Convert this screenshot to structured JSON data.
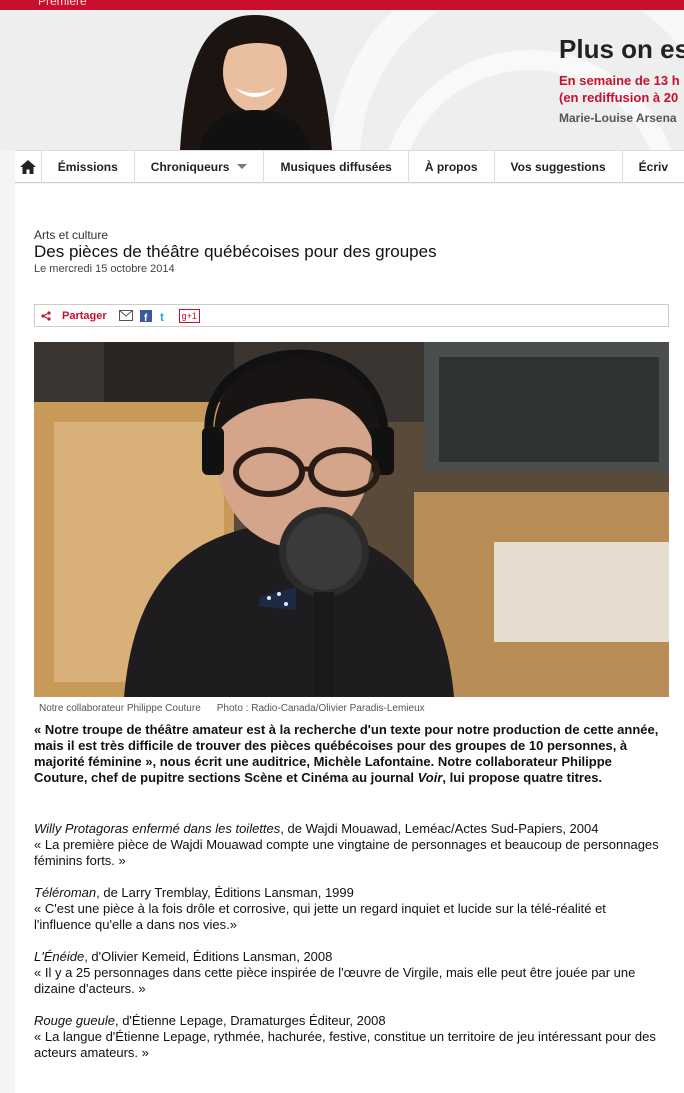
{
  "header": {
    "brand": "Première",
    "show_title": "Plus on es",
    "schedule_line1": "En semaine de 13 h",
    "schedule_line2": "(en rediffusion à 20",
    "host": "Marie-Louise Arsena"
  },
  "nav": {
    "items": [
      "Émissions",
      "Chroniqueurs",
      "Musiques diffusées",
      "À propos",
      "Vos suggestions",
      "Écriv"
    ]
  },
  "article": {
    "category": "Arts et culture",
    "title": "Des pièces de théâtre québécoises pour des groupes",
    "date": "Le mercredi 15 octobre 2014",
    "share_label": "Partager",
    "gplus_label": "g+1",
    "caption": "Notre collaborateur Philippe Couture",
    "credit": "Photo : Radio-Canada/Olivier Paradis-Lemieux",
    "lede_a": "« Notre troupe de théâtre amateur est à la recherche d'un texte pour notre production de cette année, mais il est très difficile de trouver des pièces québécoises pour des groupes de 10 personnes, à majorité féminine », nous écrit une auditrice, Michèle Lafontaine. Notre collaborateur Philippe Couture, chef de pupitre sections Scène et Cinéma au journal ",
    "lede_em": "Voir",
    "lede_b": ", lui propose quatre titres.",
    "books": [
      {
        "title": "Willy Protagoras enfermé dans les toilettes",
        "meta": ", de Wajdi Mouawad, Leméac/Actes Sud-Papiers, 2004",
        "quote": "« La première pièce de Wajdi Mouawad compte une vingtaine de personnages et beaucoup de personnages féminins forts. »"
      },
      {
        "title": "Téléroman",
        "meta": ", de Larry Tremblay, Éditions Lansman, 1999",
        "quote": "« C'est une pièce à la fois drôle et corrosive, qui jette un regard inquiet et lucide sur la télé-réalité et l'influence qu'elle a dans nos vies.»"
      },
      {
        "title": "L'Énéide",
        "meta": ", d'Olivier Kemeid, Éditions Lansman, 2008",
        "quote": "« Il y a 25 personnages dans cette pièce inspirée de l'œuvre de Virgile, mais elle peut être jouée par une dizaine d'acteurs. »"
      },
      {
        "title": "Rouge gueule",
        "meta": ", d'Étienne Lepage, Dramaturges Éditeur, 2008",
        "quote": "« La langue d'Étienne Lepage, rythmée, hachurée, festive, constitue un territoire de jeu intéressant pour des acteurs amateurs. »"
      }
    ]
  },
  "colors": {
    "accent": "#c8102e",
    "nav_bg": "#ffffff",
    "page_bg": "#f4f4f4"
  },
  "icons": [
    "home-icon",
    "chevron-down-icon",
    "share-icon",
    "email-icon",
    "facebook-icon",
    "twitter-icon",
    "gplus-icon"
  ]
}
